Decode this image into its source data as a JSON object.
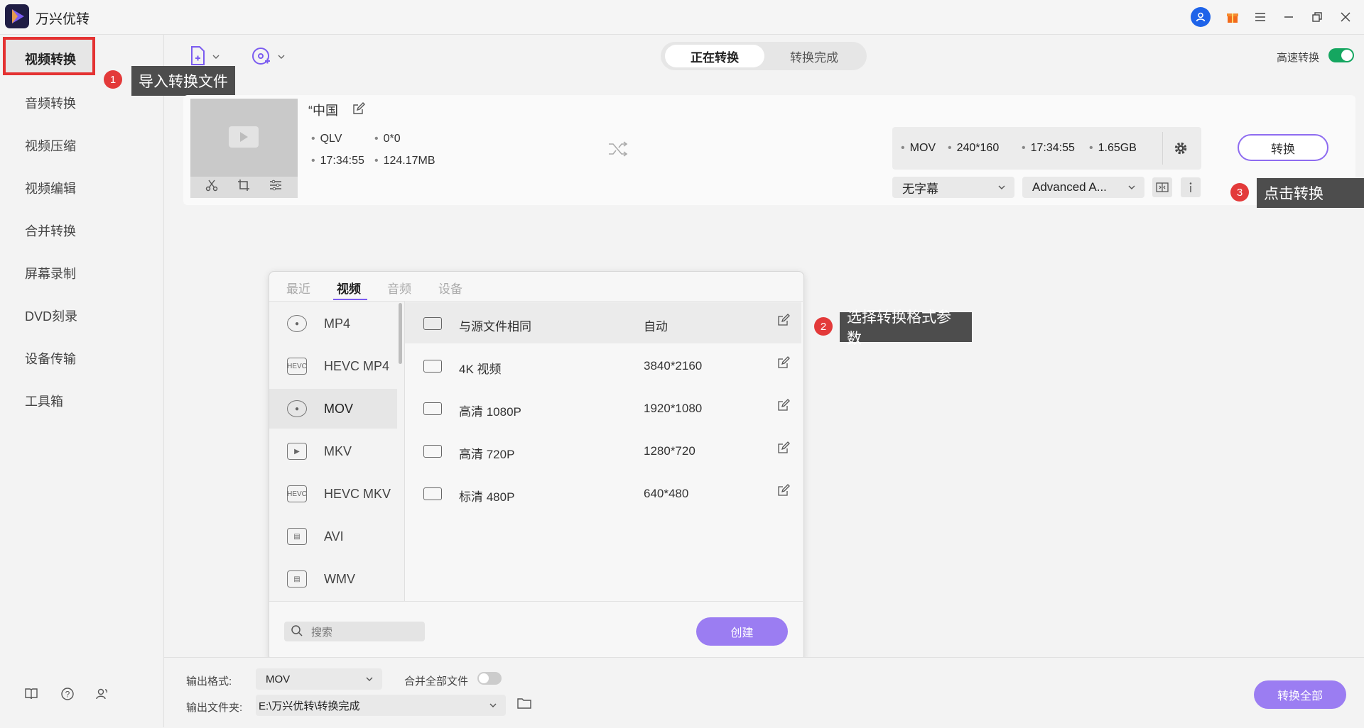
{
  "app": {
    "title": "万兴优转"
  },
  "titlebar": {
    "icons": [
      "user-icon",
      "gift-icon",
      "menu-icon",
      "minimize-icon",
      "restore-icon",
      "close-icon"
    ]
  },
  "sidebar": {
    "items": [
      {
        "label": "视频转换",
        "active": true
      },
      {
        "label": "音频转换"
      },
      {
        "label": "视频压缩"
      },
      {
        "label": "视频编辑"
      },
      {
        "label": "合并转换"
      },
      {
        "label": "屏幕录制"
      },
      {
        "label": "DVD刻录"
      },
      {
        "label": "设备传输"
      },
      {
        "label": "工具箱"
      }
    ],
    "bottom_icons": [
      "book-icon",
      "help-icon",
      "account-icon"
    ]
  },
  "annotations": [
    {
      "number": "1",
      "text": "导入转换文件"
    },
    {
      "number": "2",
      "text": "选择转换格式参数"
    },
    {
      "number": "3",
      "text": "点击转换"
    }
  ],
  "toolbar": {
    "tabs": [
      "正在转换",
      "转换完成"
    ],
    "active_tab": "正在转换",
    "high_speed_label": "高速转换",
    "high_speed_on": true,
    "accent_color": "#15a660"
  },
  "file": {
    "name": "“中国",
    "source": {
      "format": "QLV",
      "resolution": "0*0",
      "duration": "17:34:55",
      "size": "124.17MB"
    },
    "target": {
      "format": "MOV",
      "resolution": "240*160",
      "duration": "17:34:55",
      "size": "1.65GB"
    },
    "subtitle": "无字幕",
    "audio": "Advanced A...",
    "convert_label": "转换"
  },
  "format_popup": {
    "tabs": [
      "最近",
      "视频",
      "音频",
      "设备"
    ],
    "active_tab": "视频",
    "formats": [
      "MP4",
      "HEVC MP4",
      "MOV",
      "MKV",
      "HEVC MKV",
      "AVI",
      "WMV"
    ],
    "selected_format": "MOV",
    "presets": [
      {
        "name": "与源文件相同",
        "resolution": "自动"
      },
      {
        "name": "4K 视频",
        "resolution": "3840*2160"
      },
      {
        "name": "高清 1080P",
        "resolution": "1920*1080"
      },
      {
        "name": "高清 720P",
        "resolution": "1280*720"
      },
      {
        "name": "标清 480P",
        "resolution": "640*480"
      }
    ],
    "search_placeholder": "搜索",
    "create_label": "创建"
  },
  "bottom": {
    "output_format_label": "输出格式:",
    "output_format": "MOV",
    "merge_label": "合并全部文件",
    "merge_on": false,
    "output_folder_label": "输出文件夹:",
    "output_folder": "E:\\万兴优转\\转换完成",
    "convert_all_label": "转换全部"
  }
}
